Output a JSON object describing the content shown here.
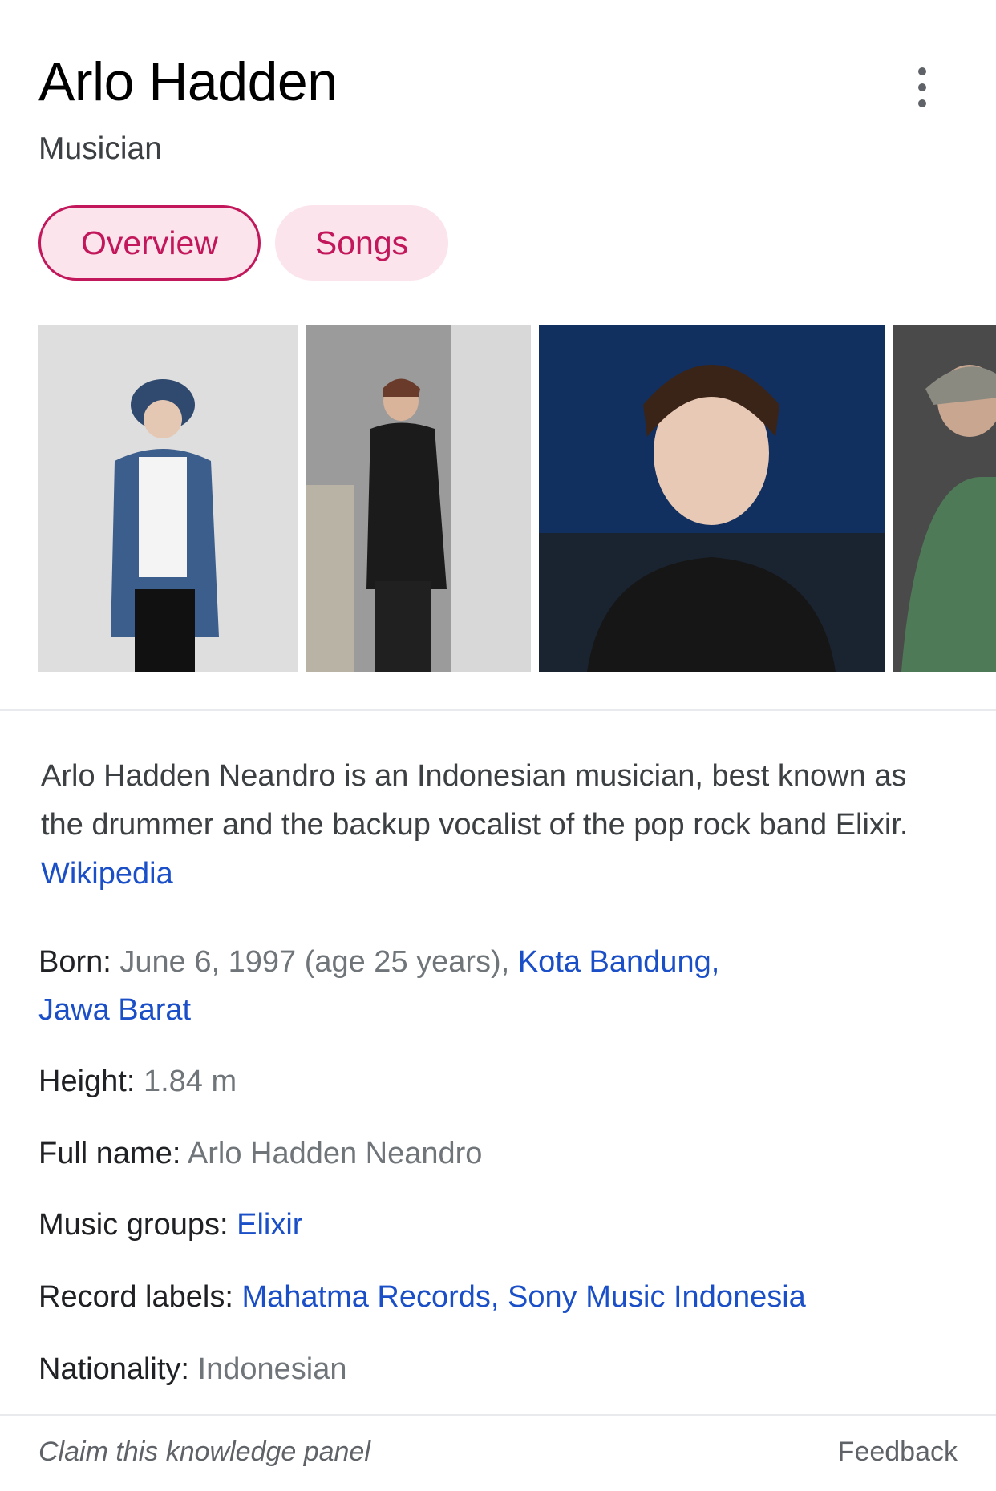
{
  "header": {
    "title": "Arlo Hadden",
    "subtitle": "Musician",
    "menu_icon": "more-vert-icon"
  },
  "tabs": [
    {
      "label": "Overview",
      "active": true
    },
    {
      "label": "Songs",
      "active": false
    }
  ],
  "description": {
    "text": "Arlo Hadden Neandro is an Indonesian musician, best known as the drummer and the backup vocalist of the pop rock band Elixir.",
    "source": "Wikipedia"
  },
  "facts": {
    "born": {
      "label": "Born:",
      "value": "June 6, 1997 (age 25 years),",
      "place_line1": "Kota Bandung,",
      "place_line2": "Jawa Barat"
    },
    "height": {
      "label": "Height:",
      "value": "1.84 m"
    },
    "full_name": {
      "label": "Full name:",
      "value": "Arlo Hadden Neandro"
    },
    "music_groups": {
      "label": "Music groups:",
      "value": "Elixir"
    },
    "record_labels": {
      "label": "Record labels:",
      "value": "Mahatma Records, Sony Music Indonesia"
    },
    "nationality": {
      "label": "Nationality:",
      "value": "Indonesian"
    }
  },
  "footer": {
    "claim": "Claim this knowledge panel",
    "feedback": "Feedback"
  },
  "colors": {
    "accent": "#c2185b",
    "accent_bg": "#fce4ec",
    "link": "#1a4fc7"
  }
}
